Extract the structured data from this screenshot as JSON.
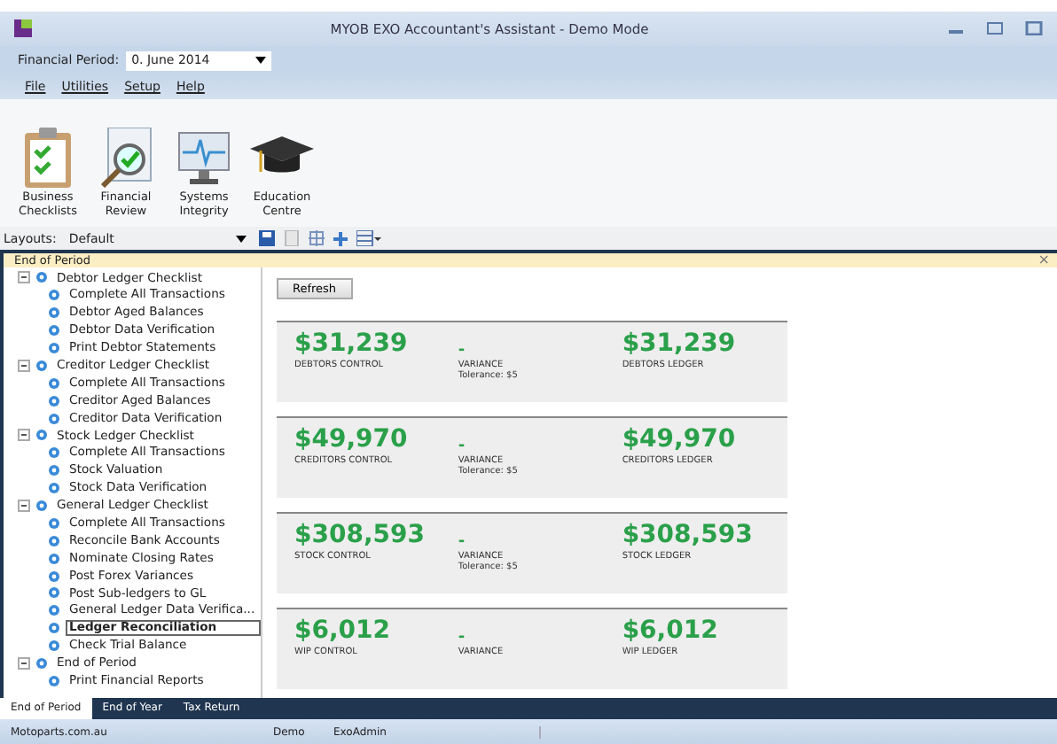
{
  "window": {
    "title": "MYOB EXO Accountant's Assistant - Demo Mode"
  },
  "period": {
    "label": "Financial Period:",
    "value": "0. June 2014"
  },
  "menu": [
    "File",
    "Utilities",
    "Setup",
    "Help"
  ],
  "ribbon": [
    {
      "kind": "checklist",
      "label": "Business Checklists"
    },
    {
      "kind": "review",
      "label": "Financial Review"
    },
    {
      "kind": "monitor",
      "label": "Systems Integrity"
    },
    {
      "kind": "cap",
      "label": "Education Centre"
    }
  ],
  "layouts": {
    "label": "Layouts:",
    "value": "Default"
  },
  "panel": {
    "title": "End of Period",
    "close": "×"
  },
  "tree": [
    {
      "label": "Debtor Ledger Checklist",
      "expanded": true,
      "children": [
        {
          "label": "Complete All Transactions",
          "selected": false
        },
        {
          "label": "Debtor Aged Balances",
          "selected": false
        },
        {
          "label": "Debtor Data Verification",
          "selected": false
        },
        {
          "label": "Print Debtor Statements",
          "selected": false
        }
      ]
    },
    {
      "label": "Creditor Ledger Checklist",
      "expanded": true,
      "children": [
        {
          "label": "Complete All Transactions",
          "selected": false
        },
        {
          "label": "Creditor Aged Balances",
          "selected": false
        },
        {
          "label": "Creditor Data Verification",
          "selected": false
        }
      ]
    },
    {
      "label": "Stock Ledger Checklist",
      "expanded": true,
      "children": [
        {
          "label": "Complete All Transactions",
          "selected": false
        },
        {
          "label": "Stock Valuation",
          "selected": false
        },
        {
          "label": "Stock Data Verification",
          "selected": false
        }
      ]
    },
    {
      "label": "General Ledger Checklist",
      "expanded": true,
      "children": [
        {
          "label": "Complete All Transactions",
          "selected": false
        },
        {
          "label": "Reconcile Bank Accounts",
          "selected": false
        },
        {
          "label": "Nominate Closing Rates",
          "selected": false
        },
        {
          "label": "Post Forex Variances",
          "selected": false
        },
        {
          "label": "Post Sub-ledgers to GL",
          "selected": false
        },
        {
          "label": "General Ledger Data Verifica...",
          "selected": false
        },
        {
          "label": "Ledger Reconciliation",
          "selected": true
        },
        {
          "label": "Check Trial Balance",
          "selected": false
        }
      ]
    },
    {
      "label": "End of Period",
      "expanded": true,
      "children": [
        {
          "label": "Print Financial Reports",
          "selected": false
        }
      ]
    }
  ],
  "refresh": "Refresh",
  "cards": [
    {
      "left_amount": "$31,239",
      "left_label": "DEBTORS CONTROL",
      "variance": "-",
      "variance_label": "VARIANCE",
      "tolerance": "Tolerance: $5",
      "right_amount": "$31,239",
      "right_label": "DEBTORS LEDGER"
    },
    {
      "left_amount": "$49,970",
      "left_label": "CREDITORS CONTROL",
      "variance": "-",
      "variance_label": "VARIANCE",
      "tolerance": "Tolerance: $5",
      "right_amount": "$49,970",
      "right_label": "CREDITORS LEDGER"
    },
    {
      "left_amount": "$308,593",
      "left_label": "STOCK CONTROL",
      "variance": "-",
      "variance_label": "VARIANCE",
      "tolerance": "Tolerance: $5",
      "right_amount": "$308,593",
      "right_label": "STOCK LEDGER"
    },
    {
      "left_amount": "$6,012",
      "left_label": "WIP CONTROL",
      "variance": "-",
      "variance_label": "VARIANCE",
      "right_amount": "$6,012",
      "right_label": "WIP LEDGER"
    }
  ],
  "tabs": [
    {
      "label": "End of Period",
      "selected": true
    },
    {
      "label": "End of Year",
      "selected": false
    },
    {
      "label": "Tax Return",
      "selected": false
    }
  ],
  "status_bar": [
    "Motoparts.com.au",
    "Demo",
    "ExoAdmin"
  ]
}
